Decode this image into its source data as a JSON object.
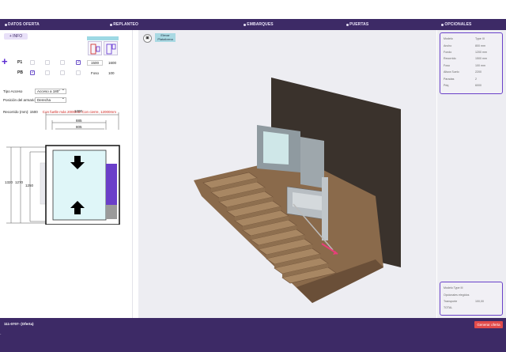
{
  "nav": {
    "tabs": [
      {
        "label": "DATOS OFERTA"
      },
      {
        "label": "REPLANTEO"
      },
      {
        "label": "EMBARQUES"
      },
      {
        "label": "PUERTAS"
      },
      {
        "label": "OPCIONALES"
      }
    ]
  },
  "left": {
    "info_label": "+ INFO",
    "plus_icon": "plus-icon",
    "rows": [
      {
        "label": "P1",
        "value": "1500",
        "value2": "1600"
      },
      {
        "label": "PB",
        "value": "Foso",
        "value2": "100"
      }
    ],
    "recorrido_label": "Recorrido (mm): 1500",
    "recorrido_warning": "Con fuelle más 2000mm Con cierre, 12000mm",
    "tipo_acceso_label": "Tipo Acceso",
    "tipo_acceso_value": "Acceso a 180°",
    "posicion_label": "Posición del armario:",
    "posicion_value": "Derecha",
    "dims": {
      "top1": "1200",
      "top2": "885",
      "top3": "805",
      "left1": "1320",
      "left2": "1270",
      "left3": "1250"
    },
    "colors": {
      "purple": "#6a3fc9",
      "teal": "#dff6f8",
      "grey": "#9a9a9a"
    }
  },
  "viewport": {
    "view_icon": "cube-view-icon",
    "elevar_label": "Elevar Plataforma"
  },
  "right": {
    "top_card": [
      {
        "k": "Modelo",
        "v": "Type III"
      },
      {
        "k": "Ancho",
        "v": "800 mm"
      },
      {
        "k": "Fondo",
        "v": "1200 mm"
      },
      {
        "k": "Recorrido",
        "v": "1500 mm"
      },
      {
        "k": "Foso",
        "v": "100 mm"
      },
      {
        "k": "Altura Suelo",
        "v": "2200"
      },
      {
        "k": "Paradas",
        "v": "2"
      },
      {
        "k": "Pdq",
        "v": "6000"
      }
    ],
    "bottom_card": [
      {
        "k": "Modelo Type III",
        "v": ""
      },
      {
        "k": "Opcionales elegidos",
        "v": ""
      },
      {
        "k": "Transporte",
        "v": "100,00"
      },
      {
        "k": "TOTAL",
        "v": ""
      }
    ]
  },
  "footer": {
    "ref": "111-0707- (Oferta)",
    "generate_label": "Generar oferta",
    "dash": "-"
  }
}
